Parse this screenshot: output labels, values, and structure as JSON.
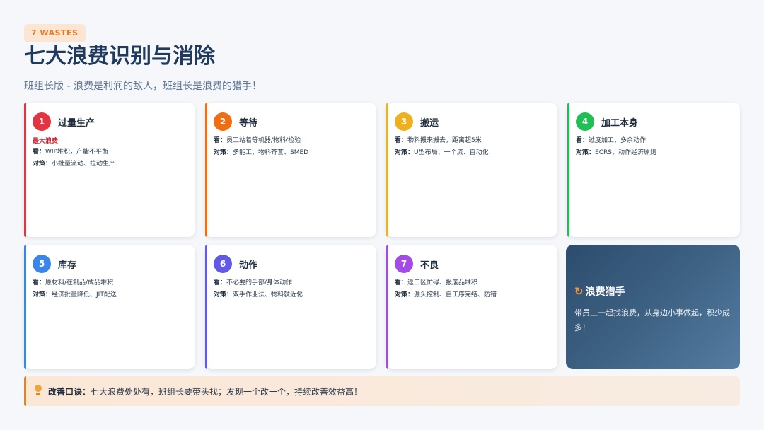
{
  "header": {
    "tag": "7 WASTES",
    "title": "七大浪费识别与消除",
    "subtitle": "班组长版 - 浪费是利润的敌人，班组长是浪费的猎手！"
  },
  "labels": {
    "look": "看：",
    "measure": "对策："
  },
  "cards": [
    {
      "num": "1",
      "title": "过量生产",
      "tagline": "最大浪费",
      "look": "WIP堆积，产能不平衡",
      "measure": "小批量流动、拉动生产",
      "color": "#e5343f"
    },
    {
      "num": "2",
      "title": "等待",
      "look": "员工站着等机器/物料/检验",
      "measure": "多能工、物料齐套、SMED",
      "color": "#f06d12"
    },
    {
      "num": "3",
      "title": "搬运",
      "look": "物料搬来搬去，距离超5米",
      "measure": "U型布局、一个流、自动化",
      "color": "#efb01d"
    },
    {
      "num": "4",
      "title": "加工本身",
      "look": "过度加工、多余动作",
      "measure": "ECRS、动作经济原则",
      "color": "#1fbf53"
    },
    {
      "num": "5",
      "title": "库存",
      "look": "原材料/在制品/成品堆积",
      "measure": "经济批量降低、JIT配送",
      "color": "#3a86e8"
    },
    {
      "num": "6",
      "title": "动作",
      "look": "不必要的手部/身体动作",
      "measure": "双手作业法、物料就近化",
      "color": "#6259e6"
    },
    {
      "num": "7",
      "title": "不良",
      "look": "返工区忙碌、报废品堆积",
      "measure": "源头控制、自工序完结、防错",
      "color": "#a34be6"
    }
  ],
  "hunter": {
    "icon": "refresh-icon",
    "title": "浪费猎手",
    "text": "带员工一起找浪费，从身边小事做起，积少成多！"
  },
  "footer": {
    "icon": "lightbulb-icon",
    "label": "改善口诀：",
    "text": "七大浪费处处有，班组长要带头找；发现一个改一个，持续改善效益高！"
  }
}
